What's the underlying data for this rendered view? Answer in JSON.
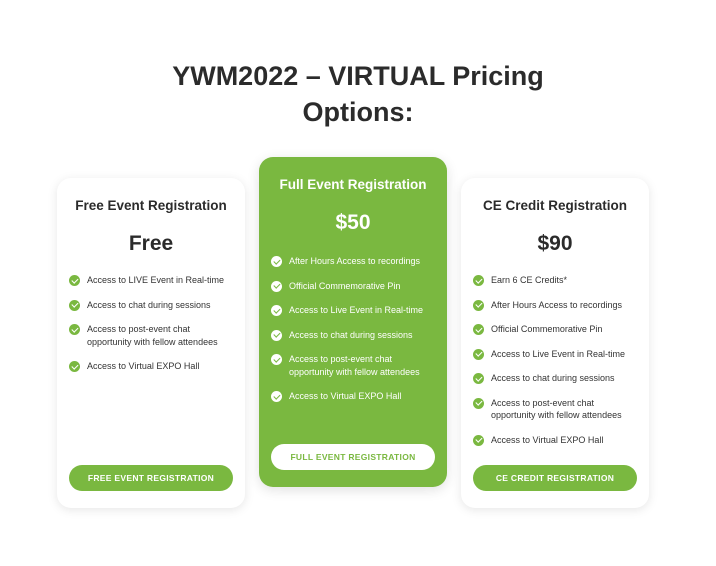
{
  "page": {
    "title_line1": "YWM2022 – VIRTUAL Pricing",
    "title_line2": "Options:"
  },
  "colors": {
    "accent": "#7ab840",
    "text": "#2b2b2b",
    "card_bg": "#ffffff"
  },
  "icons": {
    "feature_check": "check-circle-icon"
  },
  "plans": [
    {
      "title": "Free Event Registration",
      "price": "Free",
      "features": [
        "Access to LIVE Event in Real-time",
        "Access to chat during sessions",
        "Access to post-event chat opportunity with fellow attendees",
        "Access to Virtual EXPO Hall"
      ],
      "cta": "FREE EVENT REGISTRATION"
    },
    {
      "title": "Full Event Registration",
      "price": "$50",
      "features": [
        "After Hours Access to recordings",
        "Official Commemorative Pin",
        "Access to Live Event in Real-time",
        "Access to chat during sessions",
        "Access to post-event chat opportunity with fellow attendees",
        "Access to Virtual EXPO Hall"
      ],
      "cta": "FULL EVENT REGISTRATION"
    },
    {
      "title": "CE Credit Registration",
      "price": "$90",
      "features": [
        "Earn 6 CE Credits*",
        "After Hours Access to recordings",
        "Official Commemorative Pin",
        "Access to Live Event in Real-time",
        "Access to chat during sessions",
        "Access to post-event chat opportunity with fellow attendees",
        "Access to Virtual EXPO Hall"
      ],
      "cta": "CE CREDIT REGISTRATION"
    }
  ]
}
